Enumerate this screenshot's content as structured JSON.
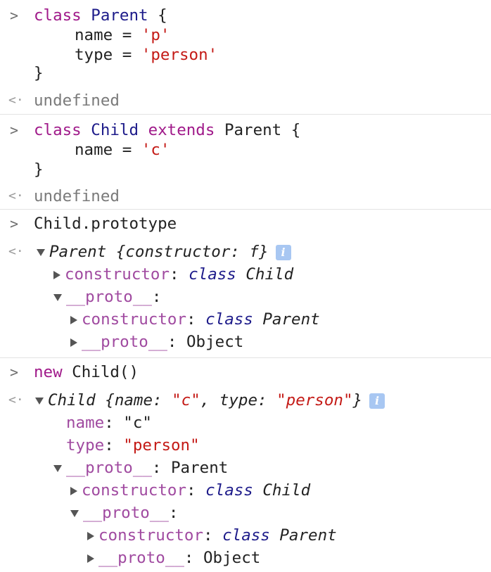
{
  "console": {
    "prompt_symbol": ">",
    "result_symbol": "<·",
    "undefined_label": "undefined",
    "entry1": {
      "kw_class": "class",
      "name": "Parent",
      "brace_open": "{",
      "field1_name": "name",
      "field1_value": "'p'",
      "field2_name": "type",
      "field2_value": "'person'",
      "brace_close": "}"
    },
    "entry2": {
      "kw_class": "class",
      "name": "Child",
      "kw_extends": "extends",
      "parent": "Parent",
      "brace_open": "{",
      "field1_name": "name",
      "field1_value": "'c'",
      "brace_close": "}"
    },
    "entry3": {
      "input": "Child.prototype",
      "summary": "Parent {constructor: f}",
      "row1_prop": "constructor",
      "row1_value_kw": "class",
      "row1_value": "Child",
      "row2_prop": "__proto__",
      "row3_prop": "constructor",
      "row3_value_kw": "class",
      "row3_value": "Parent",
      "row4_prop": "__proto__",
      "row4_value": "Object"
    },
    "entry4": {
      "kw_new": "new",
      "input_rest": "Child()",
      "summary_label": "Child {",
      "summary_p1": "name",
      "summary_v1": "\"c\"",
      "summary_p2": "type",
      "summary_v2": "\"person\"",
      "summary_close": "}",
      "name_prop": "name",
      "name_value": "\"c\"",
      "type_prop": "type",
      "type_value": "\"person\"",
      "proto_prop": "__proto__",
      "proto_value": "Parent",
      "ctor_prop": "constructor",
      "ctor_kw": "class",
      "ctor_value": "Child",
      "proto2_prop": "__proto__",
      "ctor2_prop": "constructor",
      "ctor2_kw": "class",
      "ctor2_value": "Parent",
      "proto3_prop": "__proto__",
      "proto3_value": "Object"
    }
  },
  "colors": {
    "keyword": "#a01a8a",
    "class_name": "#1d1b8a",
    "string": "#c41a16",
    "property": "#a04aa0",
    "info_badge": "#a8c7f2"
  }
}
